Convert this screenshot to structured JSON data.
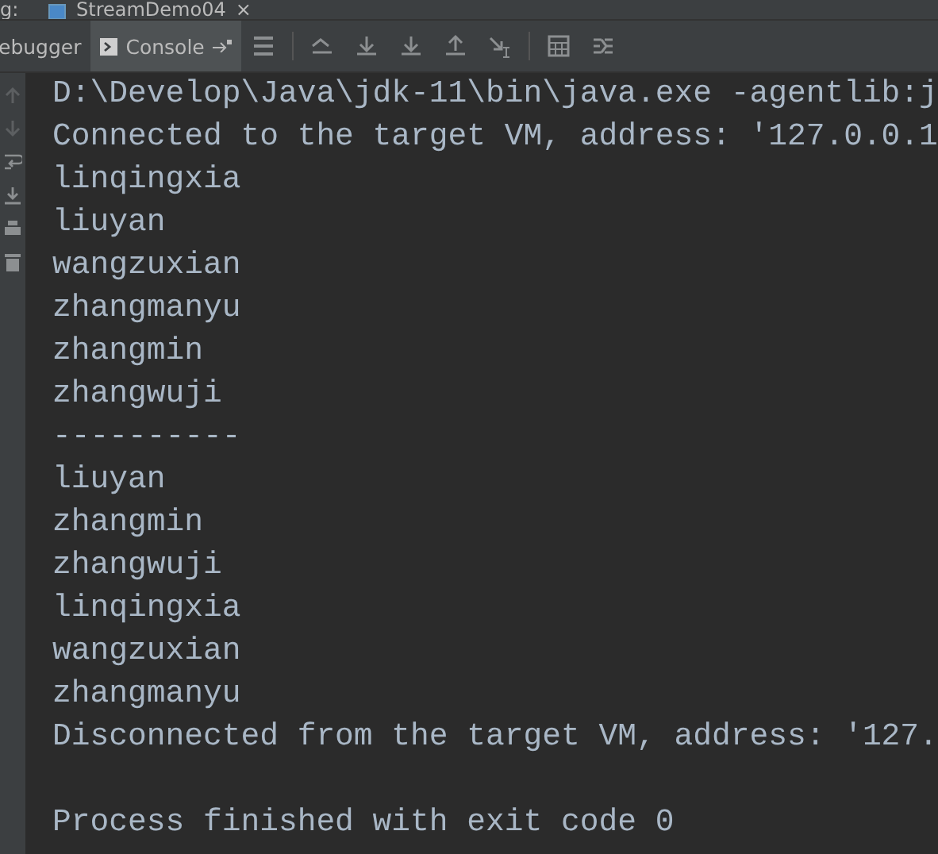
{
  "top_bar": {
    "label": "g:",
    "tab": {
      "title": "StreamDemo04",
      "close": "×"
    }
  },
  "tabs": [
    {
      "label": "ebugger",
      "selected": false
    },
    {
      "label": "Console",
      "selected": true
    }
  ],
  "console": {
    "lines": [
      "D:\\Develop\\Java\\jdk-11\\bin\\java.exe -agentlib:j",
      "Connected to the target VM, address: '127.0.0.1",
      "linqingxia",
      "liuyan",
      "wangzuxian",
      "zhangmanyu",
      "zhangmin",
      "zhangwuji",
      "----------",
      "liuyan",
      "zhangmin",
      "zhangwuji",
      "linqingxia",
      "wangzuxian",
      "zhangmanyu",
      "Disconnected from the target VM, address: '127."
    ],
    "exit_message": "Process finished with exit code 0"
  }
}
